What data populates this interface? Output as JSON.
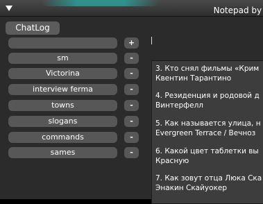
{
  "window": {
    "title": "Notepad by Pa"
  },
  "toolbar": {
    "tab_label": "ChatLog"
  },
  "entries": [
    {
      "label": "",
      "action": "+"
    },
    {
      "label": "sm",
      "action": "-"
    },
    {
      "label": "Victorina",
      "action": "-"
    },
    {
      "label": "interview ferma",
      "action": "-"
    },
    {
      "label": "towns",
      "action": "-"
    },
    {
      "label": "slogans",
      "action": "-"
    },
    {
      "label": "commands",
      "action": "-"
    },
    {
      "label": "sames",
      "action": "-"
    }
  ],
  "notes": [
    "3. Кто снял фильмы «Крим",
    "Квентин Тарантино",
    "4. Резиденция и родовой д",
    "Винтерфелл",
    "5. Как называется улица, н",
    "Evergreen Terrace / Вечноз",
    "6. Какой цвет таблетки вы",
    "Красную",
    "7. Как зовут отца Люка Ска",
    "Энакин Скайуокер"
  ]
}
